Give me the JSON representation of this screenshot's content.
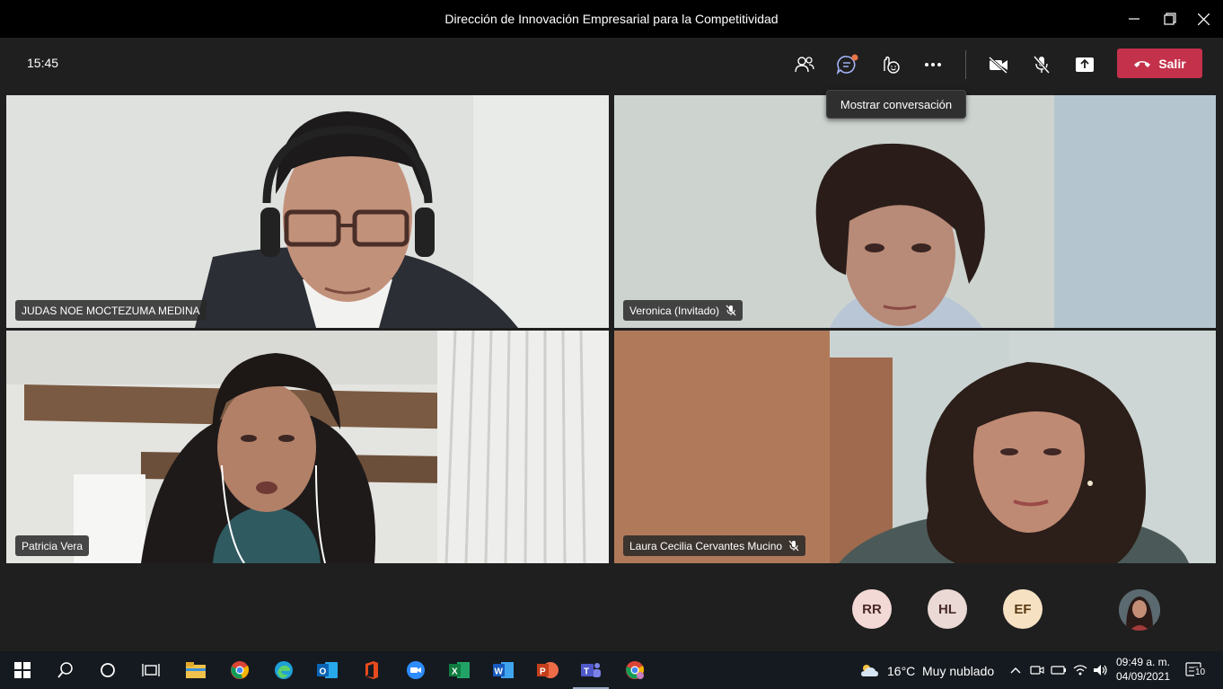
{
  "window": {
    "title": "Dirección de Innovación Empresarial para la Competitividad",
    "minimize_icon": "minimize-icon",
    "maximize_icon": "restore-icon",
    "close_icon": "close-icon"
  },
  "toolbar": {
    "time": "15:45",
    "icons": [
      "participants-icon",
      "chat-icon",
      "reactions-icon",
      "more-icon",
      "camera-off-icon",
      "mic-off-icon",
      "share-icon"
    ],
    "leave_label": "Salir",
    "tooltip": "Mostrar conversación"
  },
  "participants": [
    {
      "name": "JUDAS NOE MOCTEZUMA MEDINA",
      "muted": false
    },
    {
      "name": "Veronica (Invitado)",
      "muted": true
    },
    {
      "name": "Patricia Vera",
      "muted": false
    },
    {
      "name": "Laura Cecilia Cervantes Mucino",
      "muted": true
    }
  ],
  "avatars": [
    {
      "initials": "RR"
    },
    {
      "initials": "HL"
    },
    {
      "initials": "EF"
    }
  ],
  "taskbar": {
    "weather_temp": "16°C",
    "weather_desc": "Muy nublado",
    "time": "09:49 a. m.",
    "date": "04/09/2021",
    "notification_count": "10",
    "apps": [
      "windows-start-icon",
      "search-icon",
      "cortana-icon",
      "task-view-icon",
      "file-explorer-icon",
      "chrome-icon",
      "edge-icon",
      "outlook-icon",
      "office-icon",
      "zoom-icon",
      "excel-icon",
      "word-icon",
      "powerpoint-icon",
      "teams-icon",
      "chrome-alt-icon"
    ]
  },
  "colors": {
    "leave_button": "#c4314b",
    "chat_badge": "#e97548",
    "toolbar_bg": "#1f1f1f",
    "taskbar_bg": "#151a20"
  }
}
